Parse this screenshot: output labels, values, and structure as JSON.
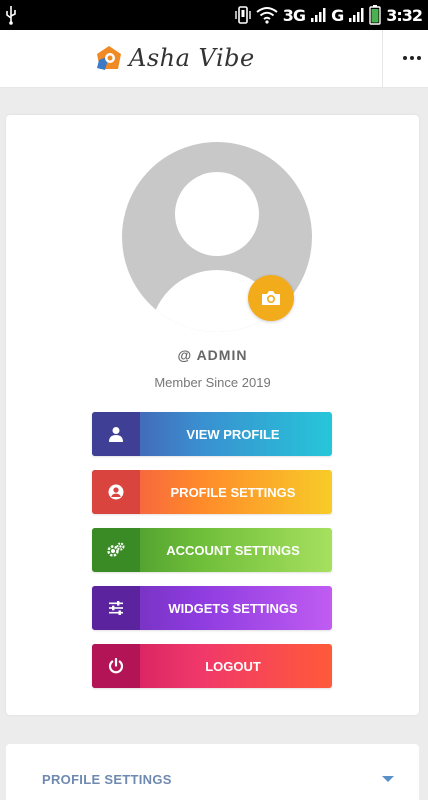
{
  "status_bar": {
    "network": "3G",
    "network2": "G",
    "time": "3:32"
  },
  "app_bar": {
    "brand": "Asha Vibe",
    "menu_icon": "more-horizontal-icon"
  },
  "profile": {
    "username": "@ ADMIN",
    "member_since": "Member Since 2019",
    "avatar_icon": "user-avatar-placeholder",
    "camera_icon": "camera-icon",
    "camera_color": "#f2ab1a"
  },
  "actions": [
    {
      "label": "VIEW PROFILE",
      "icon": "user-icon"
    },
    {
      "label": "PROFILE SETTINGS",
      "icon": "user-circle-icon"
    },
    {
      "label": "ACCOUNT SETTINGS",
      "icon": "cogs-icon"
    },
    {
      "label": "WIDGETS SETTINGS",
      "icon": "sliders-icon"
    },
    {
      "label": "LOGOUT",
      "icon": "power-icon"
    }
  ],
  "section": {
    "title": "PROFILE SETTINGS",
    "icon": "caret-down-icon"
  }
}
